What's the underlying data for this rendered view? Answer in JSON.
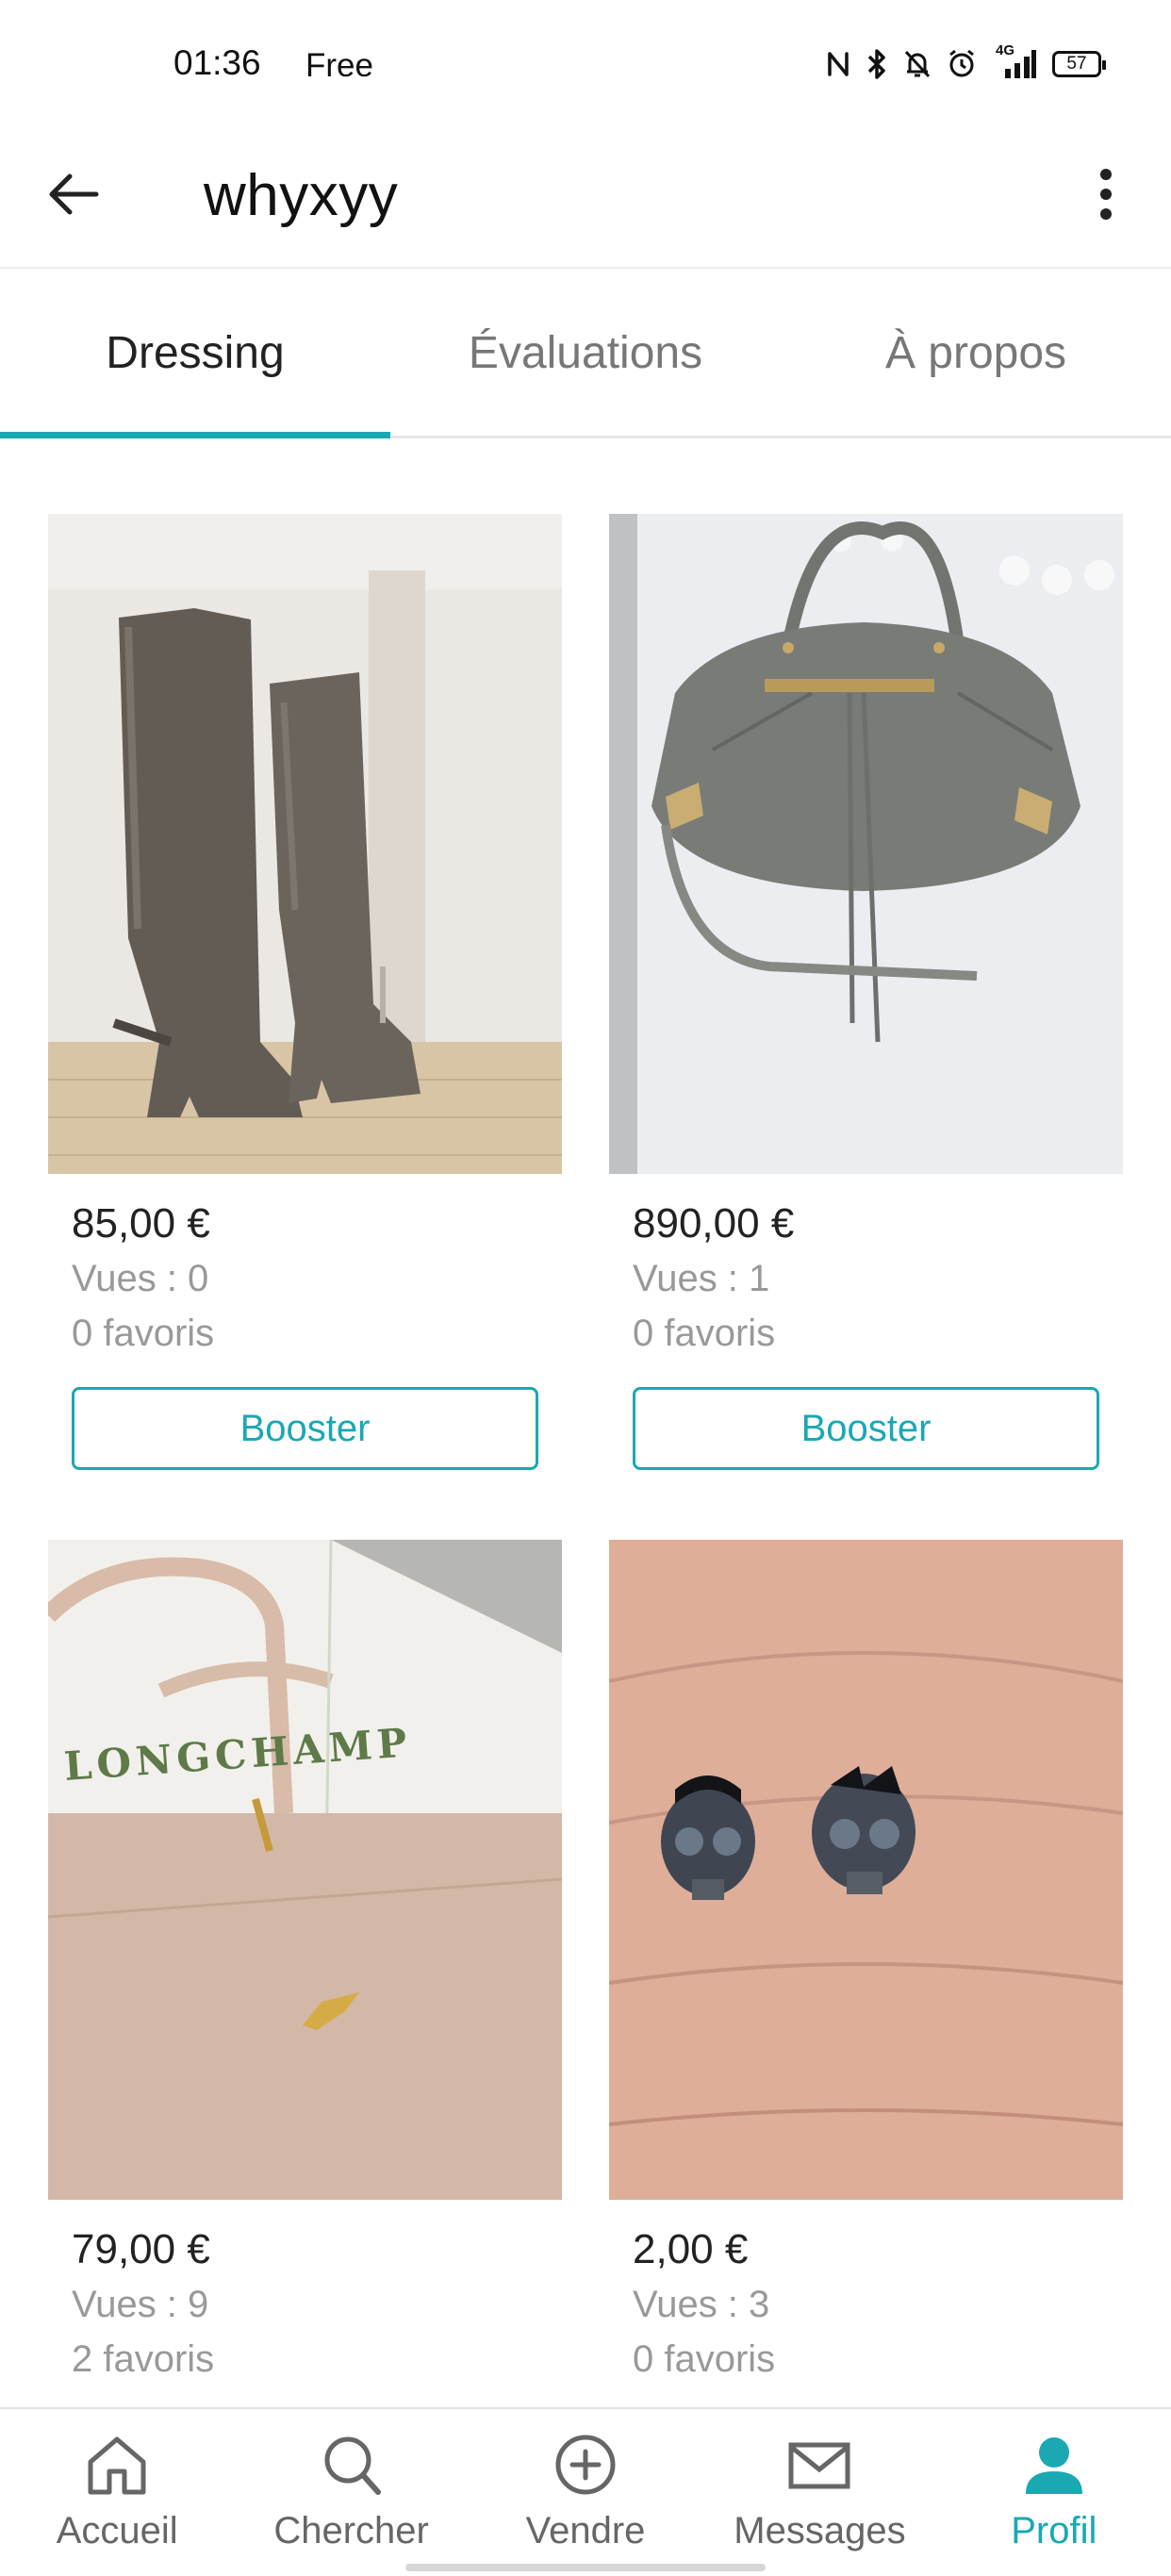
{
  "status_bar": {
    "time": "01:36",
    "carrier": "Free",
    "network_label": "4G",
    "battery": "57",
    "icons": [
      "nfc-icon",
      "bluetooth-icon",
      "mute-bell-icon",
      "alarm-icon",
      "signal-icon",
      "battery-icon"
    ]
  },
  "header": {
    "title": "whyxyy",
    "back_icon": "arrow-left-icon",
    "more_icon": "more-vertical-icon"
  },
  "tabs": [
    {
      "label": "Dressing",
      "active": true
    },
    {
      "label": "Évaluations",
      "active": false
    },
    {
      "label": "À propos",
      "active": false
    }
  ],
  "items": [
    {
      "image": "grey suede over-the-knee boots",
      "price": "85,00 €",
      "views": "Vues : 0",
      "favorites": "0 favoris",
      "button": "Booster"
    },
    {
      "image": "grey leather handbag",
      "price": "890,00 €",
      "views": "Vues : 1",
      "favorites": "0 favoris",
      "button": "Booster"
    },
    {
      "image": "beige Longchamp clutch",
      "image_text": "LONGCHAMP",
      "price": "79,00 €",
      "views": "Vues : 9",
      "favorites": "2 favoris"
    },
    {
      "image": "skull stud earrings",
      "price": "2,00 €",
      "views": "Vues : 3",
      "favorites": "0 favoris"
    }
  ],
  "bottom_nav": [
    {
      "label": "Accueil",
      "icon": "home-icon",
      "active": false
    },
    {
      "label": "Chercher",
      "icon": "search-icon",
      "active": false
    },
    {
      "label": "Vendre",
      "icon": "plus-circle-icon",
      "active": false
    },
    {
      "label": "Messages",
      "icon": "mail-icon",
      "active": false
    },
    {
      "label": "Profil",
      "icon": "profile-icon",
      "active": true
    }
  ],
  "colors": {
    "accent": "#1aa8b3",
    "text_primary": "#222222",
    "text_secondary": "#999999"
  }
}
